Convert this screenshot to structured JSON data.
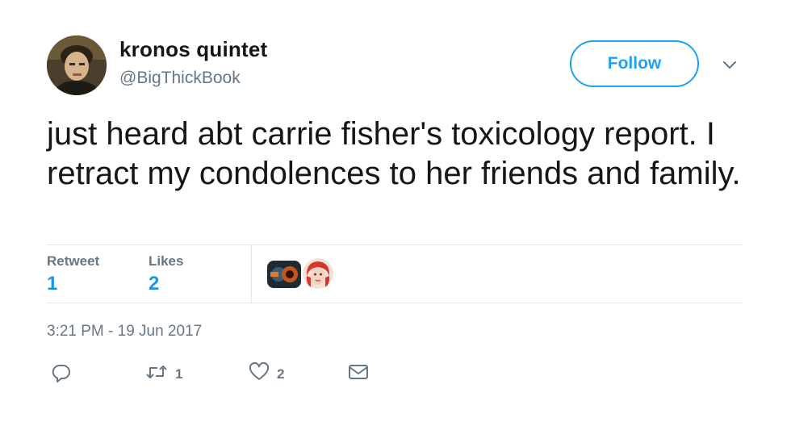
{
  "header": {
    "display_name": "kronos quintet",
    "handle": "@BigThickBook",
    "follow_label": "Follow"
  },
  "tweet": {
    "text": "just heard abt carrie fisher's toxicology report. I retract my condolences to her friends and family."
  },
  "stats": {
    "retweets_label": "Retweet",
    "retweets_count": "1",
    "likes_label": "Likes",
    "likes_count": "2"
  },
  "timestamp": "3:21 PM - 19 Jun 2017",
  "actions": {
    "retweet_count": "1",
    "like_count": "2"
  },
  "icons": {
    "reply": "reply-icon",
    "retweet": "retweet-icon",
    "like": "heart-icon",
    "dm": "envelope-icon",
    "caret": "chevron-down-icon"
  },
  "colors": {
    "accent": "#1da1f2",
    "count_blue": "#1b95e0",
    "muted": "#657786",
    "divider": "#e1e8ed"
  }
}
